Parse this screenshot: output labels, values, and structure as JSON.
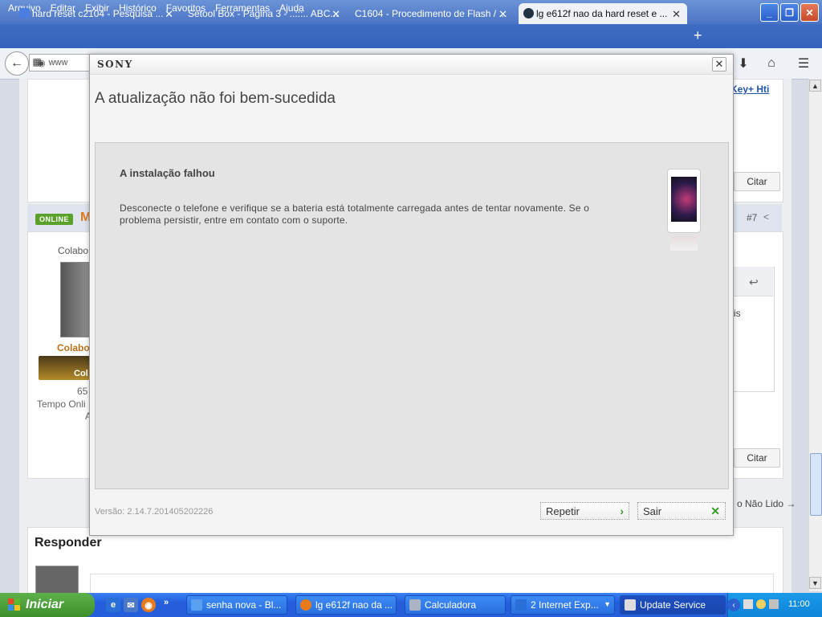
{
  "browser": {
    "menu": [
      "Arquivo",
      "Editar",
      "Exibir",
      "Histórico",
      "Favoritos",
      "Ferramentas",
      "Ajuda"
    ],
    "tabs": [
      {
        "label": "hard reset c2104 - Pesquisa ..."
      },
      {
        "label": "Setool Box - Página 3 - ..:::.. ABC..."
      },
      {
        "label": "C1604 - Procedimento de Flash / ..."
      },
      {
        "label": "lg e612f nao da hard reset e ..."
      }
    ],
    "url_partial": "www"
  },
  "forum": {
    "key_link": "Key+ Hti",
    "citar": "Citar",
    "online": "ONLINE",
    "post_initial": "M",
    "post_number": "#7",
    "colab_partial": "Colabo",
    "rank_partial": "Col",
    "count_partial": "65",
    "tempo_partial": "Tempo Onli",
    "tempo_a": "A",
    "is_partial": "is",
    "nao_lido": "o Não Lido →",
    "responder": "Responder"
  },
  "dialog": {
    "brand": "SONY",
    "title": "A atualização não foi bem-sucedida",
    "heading": "A instalação falhou",
    "message": "Desconecte o telefone e verifique se a bateria está totalmente carregada antes de tentar novamente. Se o problema persistir, entre em contato com o suporte.",
    "version": "Versão: 2.14.7.201405202226",
    "retry_label": "Repetir",
    "exit_label": "Sair"
  },
  "taskbar": {
    "start_label": "Iniciar",
    "buttons": [
      {
        "label": "senha nova - Bl..."
      },
      {
        "label": "lg e612f nao da ..."
      },
      {
        "label": "Calculadora"
      },
      {
        "label": "2 Internet Exp..."
      },
      {
        "label": "Update Service"
      }
    ],
    "clock": "11:00"
  },
  "colors": {
    "online_green": "#5aa12b",
    "accent_orange": "#e07a1a",
    "retry_chevron": "#3a9a2a",
    "exit_x": "#3a9a2a"
  }
}
